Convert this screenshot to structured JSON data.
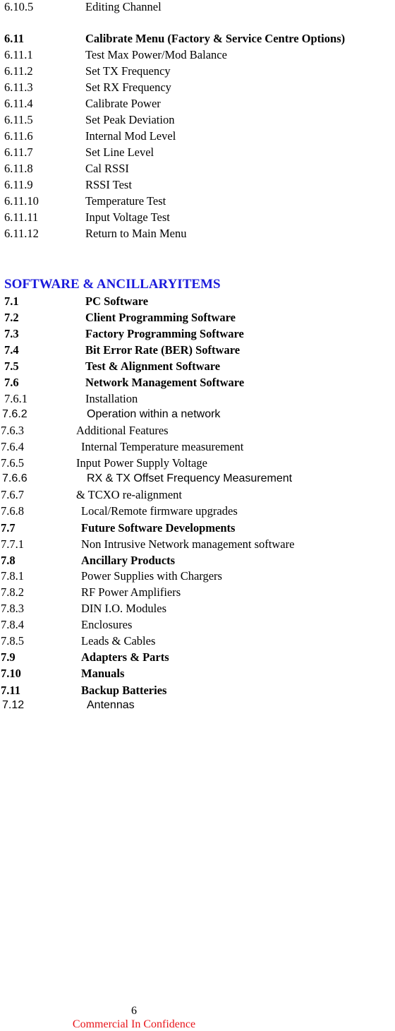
{
  "section6": {
    "prev": {
      "num": "6.10.5",
      "text": "Editing Channel"
    },
    "heading": {
      "num": "6.11",
      "text": "Calibrate Menu (Factory & Service Centre Options)"
    },
    "items": [
      {
        "num": "6.11.1",
        "text": "Test Max Power/Mod Balance"
      },
      {
        "num": "6.11.2",
        "text": "Set TX Frequency"
      },
      {
        "num": "6.11.3",
        "text": "Set RX Frequency"
      },
      {
        "num": "6.11.4",
        "text": "Calibrate Power"
      },
      {
        "num": "6.11.5",
        "text": "Set Peak Deviation"
      },
      {
        "num": "6.11.6",
        "text": "Internal Mod Level"
      },
      {
        "num": "6.11.7",
        "text": "Set Line Level"
      },
      {
        "num": "6.11.8",
        "text": "Cal RSSI"
      },
      {
        "num": "6.11.9",
        "text": "RSSI Test"
      },
      {
        "num": "6.11.10",
        "text": "Temperature Test"
      },
      {
        "num": "6.11.11",
        "text": "Input Voltage Test"
      },
      {
        "num": "6.11.12",
        "text": "Return to Main Menu"
      }
    ]
  },
  "section7": {
    "title": "SOFTWARE & ANCILLARYITEMS",
    "title_color": "#1a1adb",
    "items": [
      {
        "num": "7.1",
        "text": "PC Software"
      },
      {
        "num": "7.2",
        "text": "Client  Programming Software"
      },
      {
        "num": "7.3",
        "text": "Factory Programming Software"
      },
      {
        "num": "7.4",
        "text": "Bit Error Rate (BER) Software"
      },
      {
        "num": "7.5",
        "text": "Test & Alignment Software"
      },
      {
        "num": "7.6",
        "text": "Network Management Software"
      },
      {
        "num": "7.6.1",
        "text": "Installation"
      },
      {
        "num": "7.6.2",
        "text": "Operation within a network"
      },
      {
        "num": "7.6.3",
        "text": "Additional Features"
      },
      {
        "num": "7.6.4",
        "text": "Internal Temperature measurement"
      },
      {
        "num": "7.6.5",
        "text": "Input Power Supply Voltage"
      },
      {
        "num": "7.6.6",
        "text": "RX & TX Offset Frequency Measurement"
      },
      {
        "num": "7.6.7",
        "text": "& TCXO re-alignment"
      },
      {
        "num": "7.6.8",
        "text": "Local/Remote firmware upgrades"
      },
      {
        "num": "7.7",
        "text": "Future Software Developments"
      },
      {
        "num": "7.7.1",
        "text": "Non Intrusive Network management software"
      },
      {
        "num": "7.8",
        "text": "Ancillary Products"
      },
      {
        "num": "7.8.1",
        "text": "Power Supplies with Chargers"
      },
      {
        "num": "7.8.2",
        "text": "RF Power Amplifiers"
      },
      {
        "num": "7.8.3",
        "text": "DIN I.O. Modules"
      },
      {
        "num": "7.8.4",
        "text": "Enclosures"
      },
      {
        "num": "7.8.5",
        "text": "Leads & Cables"
      },
      {
        "num": "7.9",
        "text": "Adapters & Parts"
      },
      {
        "num": "7.10",
        "text": "Manuals"
      },
      {
        "num": "7.11",
        "text": "Backup Batteries"
      },
      {
        "num": "7.12",
        "text": "Antennas"
      }
    ]
  },
  "footer": {
    "page_number": "6",
    "confidentiality": "Commercial In Confidence",
    "confidentiality_color": "#e8141a"
  }
}
